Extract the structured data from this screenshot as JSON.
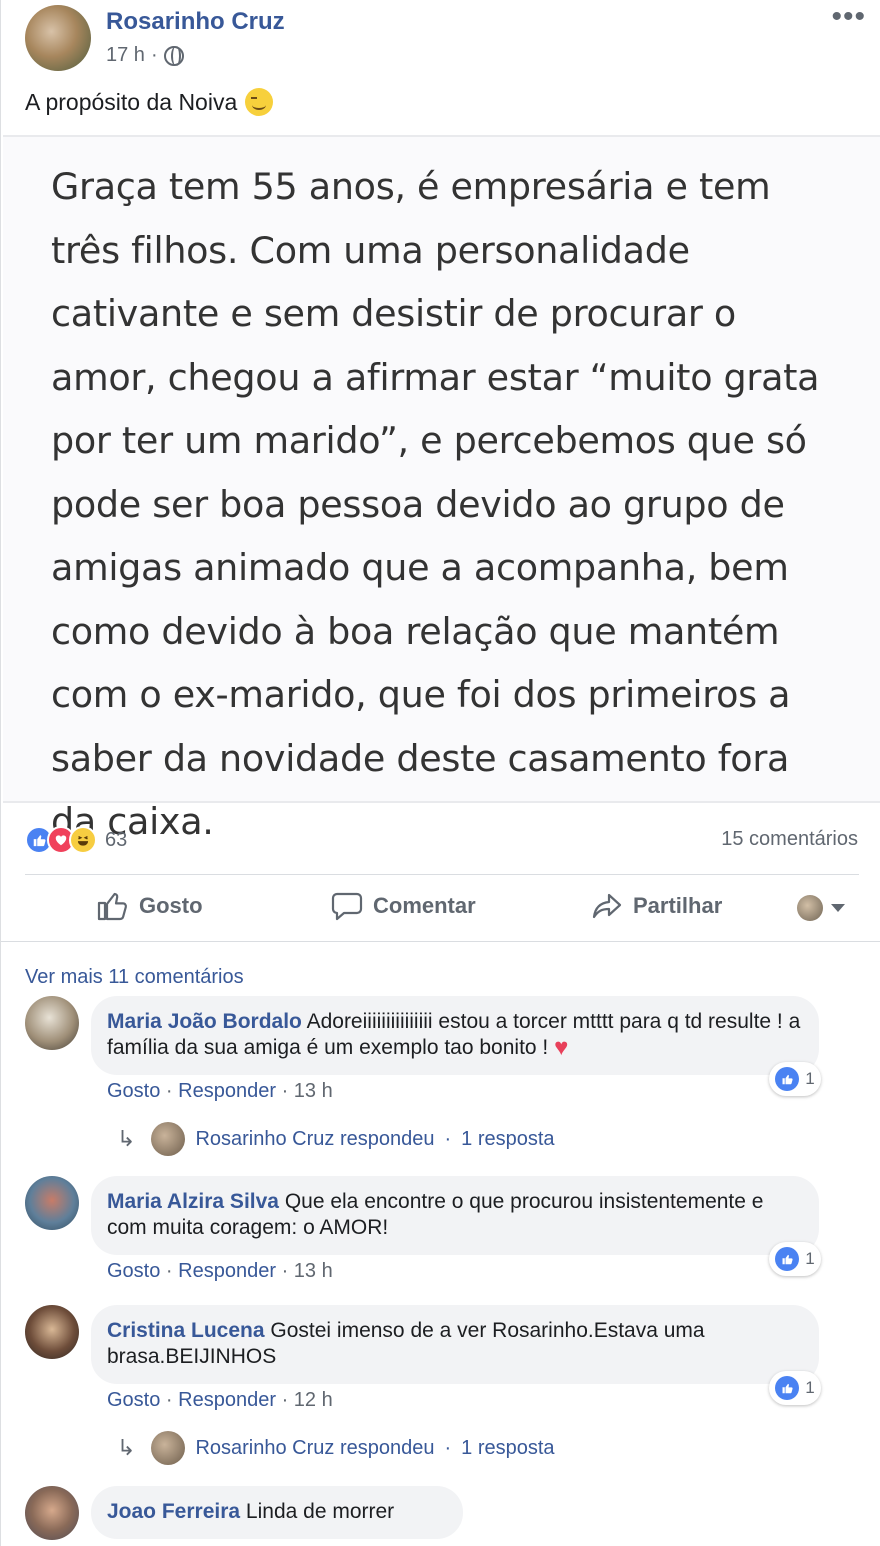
{
  "post": {
    "author": "Rosarinho Cruz",
    "time": "17 h",
    "meta_sep": "·",
    "more_icon": "•••",
    "caption": "A propósito da Noiva"
  },
  "shared_image": {
    "text": "Graça tem 55 anos, é empresária e tem três filhos. Com uma personalidade cativante e sem desistir de procurar o amor, chegou a afirmar estar “muito grata por ter um marido”, e percebemos que só pode ser boa pessoa devido ao grupo de amigas animado que a acompanha, bem como devido à boa relação que mantém com o ex-marido, que foi dos primeiros a saber da novidade deste casamento fora da caixa."
  },
  "reactions": {
    "count": "63",
    "comments": "15 comentários"
  },
  "actions": {
    "like": "Gosto",
    "comment": "Comentar",
    "share": "Partilhar"
  },
  "comments": {
    "view_more": "Ver mais 11 comentários",
    "items": [
      {
        "name": "Maria João Bordalo",
        "text": "Adoreiiiiiiiiiiiiiii estou a torcer mtttt para q td resulte ! a família da sua amiga é um exemplo tao bonito !",
        "likes": "1",
        "like": "Gosto",
        "reply": "Responder",
        "time": "13 h",
        "reply_author": "Rosarinho Cruz respondeu",
        "reply_count": "1 resposta"
      },
      {
        "name": "Maria Alzira Silva",
        "text": "Que ela encontre o que procurou insistentemente e com muita coragem: o AMOR!",
        "likes": "1",
        "like": "Gosto",
        "reply": "Responder",
        "time": "13 h"
      },
      {
        "name": "Cristina Lucena",
        "text": "Gostei imenso de a ver Rosarinho.Estava uma brasa.BEIJINHOS",
        "likes": "1",
        "like": "Gosto",
        "reply": "Responder",
        "time": "12 h",
        "reply_author": "Rosarinho Cruz respondeu",
        "reply_count": "1 resposta"
      },
      {
        "name": "Joao Ferreira",
        "text": "Linda de morrer"
      }
    ]
  },
  "sep": "·",
  "icons": {
    "privacy": "globe-icon",
    "emoji": "wink-emoji-icon",
    "like": "thumbs-up-icon",
    "comment": "speech-bubble-icon",
    "share": "share-arrow-icon",
    "reply": "reply-arrow-icon",
    "heart": "heart-icon"
  },
  "colors": {
    "link": "#385898",
    "secondary_text": "#606770",
    "bubble": "#f2f3f5",
    "like_blue": "#4a82f2",
    "love_red": "#f0415b",
    "haha_yellow": "#f7cd41"
  }
}
